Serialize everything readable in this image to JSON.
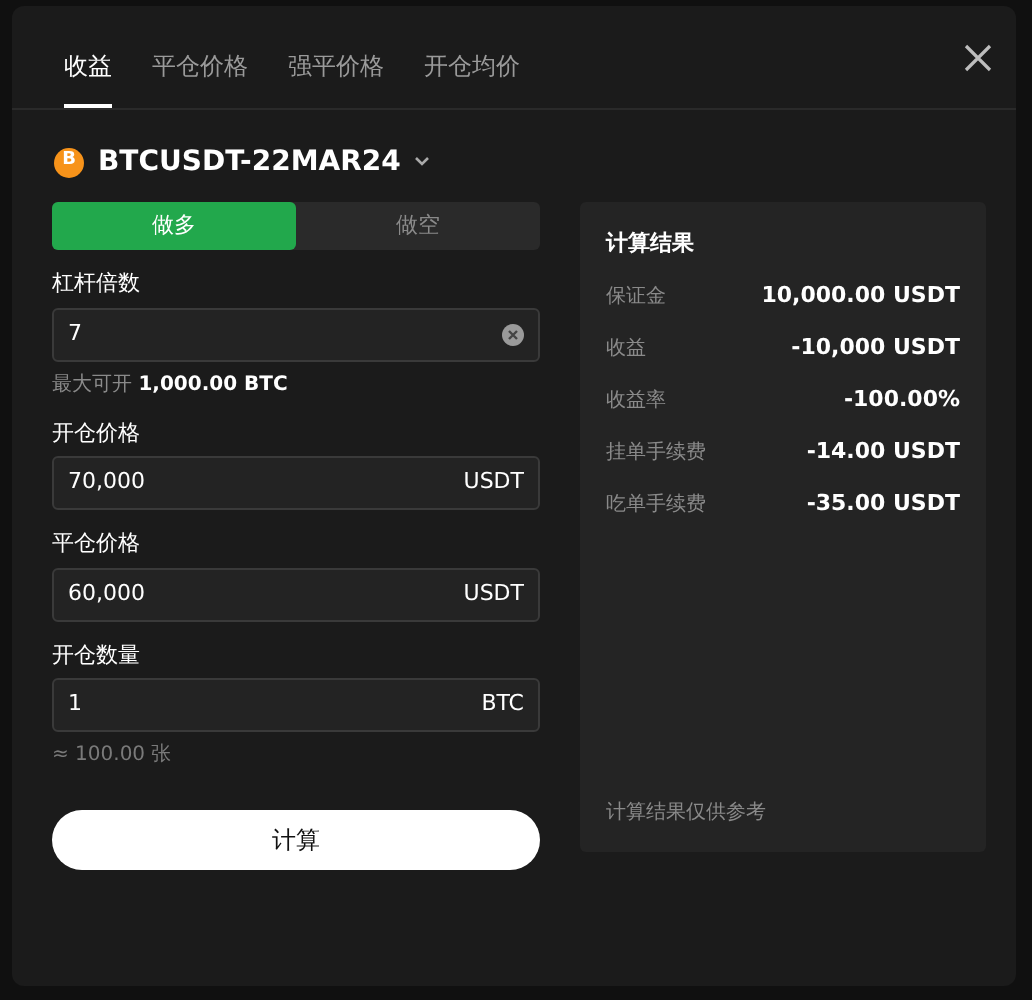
{
  "tabs": [
    {
      "label": "收益",
      "selected": true
    },
    {
      "label": "平仓价格",
      "selected": false
    },
    {
      "label": "强平价格",
      "selected": false
    },
    {
      "label": "开仓均价",
      "selected": false
    }
  ],
  "symbol": {
    "coin_glyph": "B",
    "name": "BTCUSDT-22MAR24"
  },
  "sides": [
    {
      "label": "做多",
      "selected": true
    },
    {
      "label": "做空",
      "selected": false
    }
  ],
  "leverage": {
    "label": "杠杆倍数",
    "value": "7",
    "max_label": "最大可开",
    "max_value": "1,000.00 BTC"
  },
  "fields": [
    {
      "label": "开仓价格",
      "value": "70,000",
      "unit": "USDT"
    },
    {
      "label": "平仓价格",
      "value": "60,000",
      "unit": "USDT"
    },
    {
      "label": "开仓数量",
      "value": "1",
      "unit": "BTC"
    }
  ],
  "quantity_hint": "≈ 100.00 张",
  "calculate_button": "计算",
  "results": {
    "title": "计算结果",
    "rows": [
      {
        "label": "保证金",
        "value": "10,000.00 USDT"
      },
      {
        "label": "收益",
        "value": "-10,000 USDT"
      },
      {
        "label": "收益率",
        "value": "-100.00%"
      },
      {
        "label": "挂单手续费",
        "value": "-14.00 USDT"
      },
      {
        "label": "吃单手续费",
        "value": "-35.00 USDT"
      }
    ],
    "note": "计算结果仅供参考"
  }
}
